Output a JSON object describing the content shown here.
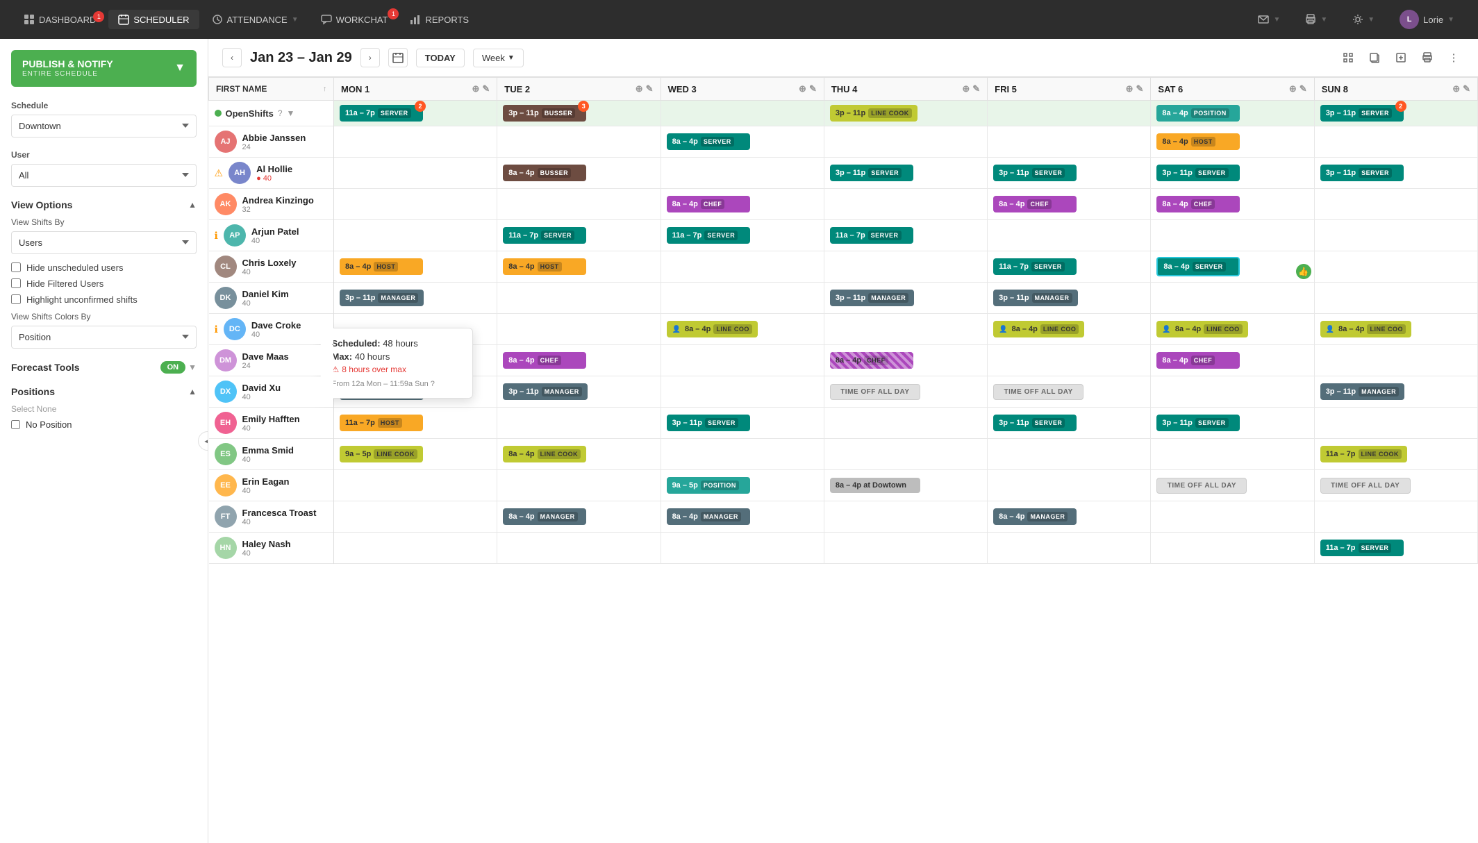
{
  "nav": {
    "items": [
      {
        "id": "dashboard",
        "label": "DASHBOARD",
        "icon": "grid-icon",
        "badge": 1,
        "active": false
      },
      {
        "id": "scheduler",
        "label": "SCHEDULER",
        "icon": "calendar-icon",
        "badge": 0,
        "active": true
      },
      {
        "id": "attendance",
        "label": "ATTENDANCE",
        "icon": "clock-icon",
        "badge": 0,
        "active": false,
        "dropdown": true
      },
      {
        "id": "workchat",
        "label": "WORKCHAT",
        "icon": "chat-icon",
        "badge": 1,
        "active": false
      },
      {
        "id": "reports",
        "label": "REPORTS",
        "icon": "bar-chart-icon",
        "badge": 0,
        "active": false
      }
    ],
    "right": [
      {
        "id": "mail",
        "icon": "mail-icon",
        "dropdown": true
      },
      {
        "id": "print",
        "icon": "print-icon",
        "dropdown": true
      },
      {
        "id": "settings",
        "icon": "settings-icon",
        "dropdown": true
      },
      {
        "id": "user",
        "label": "Lorie",
        "icon": "user-icon",
        "dropdown": true
      }
    ]
  },
  "sidebar": {
    "publish_btn": {
      "title": "PUBLISH & NOTIFY",
      "sub": "ENTIRE SCHEDULE"
    },
    "schedule": {
      "label": "Schedule",
      "value": "Downtown"
    },
    "user": {
      "label": "User",
      "value": "All"
    },
    "view_options": {
      "title": "View Options",
      "view_shifts_by": {
        "label": "View Shifts By",
        "value": "Users"
      },
      "hide_unscheduled": {
        "label": "Hide unscheduled users",
        "checked": false
      },
      "hide_filtered": {
        "label": "Hide Filtered Users",
        "checked": false
      },
      "highlight_unconfirmed": {
        "label": "Highlight unconfirmed shifts",
        "checked": false
      },
      "view_colors_by": {
        "label": "View Shifts Colors By",
        "value": "Position"
      }
    },
    "forecast_tools": {
      "title": "Forecast Tools",
      "on": true
    },
    "positions": {
      "title": "Positions",
      "select_none": "Select None",
      "items": [
        {
          "label": "No Position",
          "checked": false
        }
      ]
    }
  },
  "schedule_header": {
    "date_range": "Jan 23 – Jan 29",
    "today_label": "TODAY",
    "week_label": "Week"
  },
  "grid": {
    "first_name_col": "FIRST NAME",
    "days": [
      {
        "label": "MON 1",
        "full": "MON 1"
      },
      {
        "label": "TUE 2",
        "full": "TUE 2"
      },
      {
        "label": "WED 3",
        "full": "WED 3"
      },
      {
        "label": "THU 4",
        "full": "THU 4"
      },
      {
        "label": "FRI 5",
        "full": "FRI 5"
      },
      {
        "label": "SAT 6",
        "full": "SAT 6"
      },
      {
        "label": "SUN 8",
        "full": "SUN 8"
      }
    ],
    "open_shifts": {
      "label": "OpenShifts",
      "shifts": [
        {
          "day": 0,
          "time": "11a – 7p",
          "pos": "SERVER",
          "color": "server",
          "badge": 2
        },
        {
          "day": 1,
          "time": "3p – 11p",
          "pos": "BUSSER",
          "color": "busser",
          "badge": 3
        },
        {
          "day": 2,
          "time": "",
          "pos": "",
          "color": "",
          "badge": 0
        },
        {
          "day": 3,
          "time": "3p – 11p",
          "pos": "LINE COOK",
          "color": "linecook",
          "badge": 0
        },
        {
          "day": 4,
          "time": "",
          "pos": "",
          "color": "",
          "badge": 0
        },
        {
          "day": 5,
          "time": "8a – 4p",
          "pos": "POSITION",
          "color": "position",
          "badge": 0
        },
        {
          "day": 6,
          "time": "3p – 11p",
          "pos": "SERVER",
          "color": "server",
          "badge": 2
        }
      ]
    },
    "users": [
      {
        "name": "Abbie Janssen",
        "hours": 24,
        "warn": false,
        "warn_type": "",
        "tooltip": true,
        "tooltip_data": {
          "scheduled": "48 hours",
          "max": "40 hours",
          "over": "8 hours over max",
          "note": "From 12a Mon – 11:59a Sun"
        },
        "shifts": [
          {
            "day": 0,
            "time": "",
            "pos": "",
            "color": ""
          },
          {
            "day": 1,
            "time": "",
            "pos": "",
            "color": ""
          },
          {
            "day": 2,
            "time": "8a – 4p",
            "pos": "SERVER",
            "color": "server"
          },
          {
            "day": 3,
            "time": "",
            "pos": "",
            "color": ""
          },
          {
            "day": 4,
            "time": "",
            "pos": "",
            "color": ""
          },
          {
            "day": 5,
            "time": "8a – 4p",
            "pos": "HOST",
            "color": "host"
          },
          {
            "day": 6,
            "time": "",
            "pos": "",
            "color": ""
          }
        ]
      },
      {
        "name": "Al Hollie",
        "hours": 40,
        "warn": true,
        "warn_type": "alert",
        "shifts": [
          {
            "day": 0,
            "time": "",
            "pos": "",
            "color": ""
          },
          {
            "day": 1,
            "time": "8a – 4p",
            "pos": "BUSSER",
            "color": "busser"
          },
          {
            "day": 2,
            "time": "",
            "pos": "",
            "color": ""
          },
          {
            "day": 3,
            "time": "3p – 11p",
            "pos": "SERVER",
            "color": "server"
          },
          {
            "day": 4,
            "time": "3p – 11p",
            "pos": "SERVER",
            "color": "server"
          },
          {
            "day": 5,
            "time": "3p – 11p",
            "pos": "SERVER",
            "color": "server"
          },
          {
            "day": 6,
            "time": "3p – 11p",
            "pos": "SERVER",
            "color": "server"
          }
        ]
      },
      {
        "name": "Andrea Kinzingo",
        "hours": 32,
        "warn": false,
        "shifts": [
          {
            "day": 0,
            "time": "",
            "pos": "",
            "color": ""
          },
          {
            "day": 1,
            "time": "",
            "pos": "",
            "color": ""
          },
          {
            "day": 2,
            "time": "8a – 4p",
            "pos": "CHEF",
            "color": "chef"
          },
          {
            "day": 3,
            "time": "",
            "pos": "",
            "color": ""
          },
          {
            "day": 4,
            "time": "8a – 4p",
            "pos": "CHEF",
            "color": "chef"
          },
          {
            "day": 5,
            "time": "8a – 4p",
            "pos": "CHEF",
            "color": "chef"
          },
          {
            "day": 6,
            "time": "",
            "pos": "",
            "color": ""
          }
        ]
      },
      {
        "name": "Arjun Patel",
        "hours": 40,
        "warn": true,
        "warn_type": "info",
        "shifts": [
          {
            "day": 0,
            "time": "",
            "pos": "",
            "color": ""
          },
          {
            "day": 1,
            "time": "11a – 7p",
            "pos": "SERVER",
            "color": "server"
          },
          {
            "day": 2,
            "time": "11a – 7p",
            "pos": "SERVER",
            "color": "server"
          },
          {
            "day": 3,
            "time": "11a – 7p",
            "pos": "SERVER",
            "color": "server"
          },
          {
            "day": 4,
            "time": "",
            "pos": "",
            "color": ""
          },
          {
            "day": 5,
            "time": "",
            "pos": "",
            "color": ""
          },
          {
            "day": 6,
            "time": "",
            "pos": "",
            "color": ""
          }
        ]
      },
      {
        "name": "Chris Loxely",
        "hours": 40,
        "warn": false,
        "shifts": [
          {
            "day": 0,
            "time": "8a – 4p",
            "pos": "HOST",
            "color": "host"
          },
          {
            "day": 1,
            "time": "8a – 4p",
            "pos": "HOST",
            "color": "host"
          },
          {
            "day": 2,
            "time": "",
            "pos": "",
            "color": ""
          },
          {
            "day": 3,
            "time": "",
            "pos": "",
            "color": ""
          },
          {
            "day": 4,
            "time": "11a – 7p",
            "pos": "SERVER",
            "color": "server"
          },
          {
            "day": 5,
            "time": "8a – 4p",
            "pos": "SERVER",
            "color": "server",
            "selected": true
          },
          {
            "day": 6,
            "time": "",
            "pos": "",
            "color": ""
          }
        ]
      },
      {
        "name": "Daniel Kim",
        "hours": 40,
        "warn": false,
        "shifts": [
          {
            "day": 0,
            "time": "3p – 11p",
            "pos": "MANAGER",
            "color": "manager"
          },
          {
            "day": 1,
            "time": "",
            "pos": "",
            "color": ""
          },
          {
            "day": 2,
            "time": "",
            "pos": "",
            "color": ""
          },
          {
            "day": 3,
            "time": "3p – 11p",
            "pos": "MANAGER",
            "color": "manager"
          },
          {
            "day": 4,
            "time": "3p – 11p",
            "pos": "MANAGER",
            "color": "manager"
          },
          {
            "day": 5,
            "time": "",
            "pos": "",
            "color": ""
          },
          {
            "day": 6,
            "time": "",
            "pos": "",
            "color": ""
          }
        ]
      },
      {
        "name": "Dave Croke",
        "hours": 40,
        "warn": true,
        "warn_type": "info",
        "shifts": [
          {
            "day": 0,
            "time": "",
            "pos": "",
            "color": ""
          },
          {
            "day": 1,
            "time": "",
            "pos": "",
            "color": ""
          },
          {
            "day": 2,
            "time": "8a – 4p",
            "pos": "LINE COOK",
            "color": "linecook",
            "unassigned": true
          },
          {
            "day": 3,
            "time": "",
            "pos": "",
            "color": ""
          },
          {
            "day": 4,
            "time": "8a – 4p",
            "pos": "LINE COOK",
            "color": "linecook",
            "unassigned": true
          },
          {
            "day": 5,
            "time": "8a – 4p",
            "pos": "LINE COOK",
            "color": "linecook",
            "unassigned": true
          },
          {
            "day": 6,
            "time": "8a – 4p",
            "pos": "LINE COOK",
            "color": "linecook",
            "unassigned": true
          }
        ]
      },
      {
        "name": "Dave Maas",
        "hours": 24,
        "warn": false,
        "shifts": [
          {
            "day": 0,
            "time": "",
            "pos": "",
            "color": ""
          },
          {
            "day": 1,
            "time": "8a – 4p",
            "pos": "CHEF",
            "color": "chef"
          },
          {
            "day": 2,
            "time": "",
            "pos": "",
            "color": ""
          },
          {
            "day": 3,
            "time": "8a – 4p",
            "pos": "CHEF",
            "color": "chef",
            "striped": true
          },
          {
            "day": 4,
            "time": "",
            "pos": "",
            "color": ""
          },
          {
            "day": 5,
            "time": "8a – 4p",
            "pos": "CHEF",
            "color": "chef"
          },
          {
            "day": 6,
            "time": "",
            "pos": "",
            "color": ""
          }
        ]
      },
      {
        "name": "David Xu",
        "hours": 40,
        "warn": false,
        "shifts": [
          {
            "day": 0,
            "time": "3p – 11p",
            "pos": "MANAGER",
            "color": "manager"
          },
          {
            "day": 1,
            "time": "3p – 11p",
            "pos": "MANAGER",
            "color": "manager"
          },
          {
            "day": 2,
            "time": "",
            "pos": "",
            "color": ""
          },
          {
            "day": 3,
            "time": "TIME OFF ALL DAY",
            "pos": "",
            "color": "timeoff"
          },
          {
            "day": 4,
            "time": "TIME OFF ALL DAY",
            "pos": "",
            "color": "timeoff"
          },
          {
            "day": 5,
            "time": "",
            "pos": "",
            "color": ""
          },
          {
            "day": 6,
            "time": "3p – 11p",
            "pos": "MANAGER",
            "color": "manager"
          }
        ]
      },
      {
        "name": "Emily Hafften",
        "hours": 40,
        "warn": false,
        "shifts": [
          {
            "day": 0,
            "time": "11a – 7p",
            "pos": "HOST",
            "color": "host"
          },
          {
            "day": 1,
            "time": "",
            "pos": "",
            "color": ""
          },
          {
            "day": 2,
            "time": "3p – 11p",
            "pos": "SERVER",
            "color": "server"
          },
          {
            "day": 3,
            "time": "",
            "pos": "",
            "color": ""
          },
          {
            "day": 4,
            "time": "3p – 11p",
            "pos": "SERVER",
            "color": "server"
          },
          {
            "day": 5,
            "time": "3p – 11p",
            "pos": "SERVER",
            "color": "server"
          },
          {
            "day": 6,
            "time": "",
            "pos": "",
            "color": ""
          }
        ]
      },
      {
        "name": "Emma Smid",
        "hours": 40,
        "warn": false,
        "shifts": [
          {
            "day": 0,
            "time": "9a – 5p",
            "pos": "LINE COOK",
            "color": "linecook"
          },
          {
            "day": 1,
            "time": "8a – 4p",
            "pos": "LINE COOK",
            "color": "linecook"
          },
          {
            "day": 2,
            "time": "",
            "pos": "",
            "color": ""
          },
          {
            "day": 3,
            "time": "",
            "pos": "",
            "color": ""
          },
          {
            "day": 4,
            "time": "",
            "pos": "",
            "color": ""
          },
          {
            "day": 5,
            "time": "",
            "pos": "",
            "color": ""
          },
          {
            "day": 6,
            "time": "11a – 7p",
            "pos": "LINE COOK",
            "color": "linecook"
          }
        ]
      },
      {
        "name": "Erin Eagan",
        "hours": 40,
        "warn": false,
        "shifts": [
          {
            "day": 0,
            "time": "",
            "pos": "",
            "color": ""
          },
          {
            "day": 1,
            "time": "",
            "pos": "",
            "color": ""
          },
          {
            "day": 2,
            "time": "9a – 5p",
            "pos": "POSITION",
            "color": "position"
          },
          {
            "day": 3,
            "time": "8a – 4p at Dowtown",
            "pos": "",
            "color": "gray"
          },
          {
            "day": 4,
            "time": "",
            "pos": "",
            "color": ""
          },
          {
            "day": 5,
            "time": "TIME OFF ALL DAY",
            "pos": "",
            "color": "timeoff"
          },
          {
            "day": 6,
            "time": "TIME OFF ALL DAY",
            "pos": "",
            "color": "timeoff"
          }
        ]
      },
      {
        "name": "Francesca Troast",
        "hours": 40,
        "warn": false,
        "shifts": [
          {
            "day": 0,
            "time": "",
            "pos": "",
            "color": ""
          },
          {
            "day": 1,
            "time": "8a – 4p",
            "pos": "MANAGER",
            "color": "manager"
          },
          {
            "day": 2,
            "time": "8a – 4p",
            "pos": "MANAGER",
            "color": "manager"
          },
          {
            "day": 3,
            "time": "",
            "pos": "",
            "color": ""
          },
          {
            "day": 4,
            "time": "8a – 4p",
            "pos": "MANAGER",
            "color": "manager"
          },
          {
            "day": 5,
            "time": "",
            "pos": "",
            "color": ""
          },
          {
            "day": 6,
            "time": "",
            "pos": "",
            "color": ""
          }
        ]
      },
      {
        "name": "Haley Nash",
        "hours": 40,
        "warn": false,
        "shifts": [
          {
            "day": 0,
            "time": "",
            "pos": "",
            "color": ""
          },
          {
            "day": 1,
            "time": "",
            "pos": "",
            "color": ""
          },
          {
            "day": 2,
            "time": "",
            "pos": "",
            "color": ""
          },
          {
            "day": 3,
            "time": "",
            "pos": "",
            "color": ""
          },
          {
            "day": 4,
            "time": "",
            "pos": "",
            "color": ""
          },
          {
            "day": 5,
            "time": "",
            "pos": "",
            "color": ""
          },
          {
            "day": 6,
            "time": "11a – 7p",
            "pos": "SERVER",
            "color": "server"
          }
        ]
      }
    ]
  }
}
